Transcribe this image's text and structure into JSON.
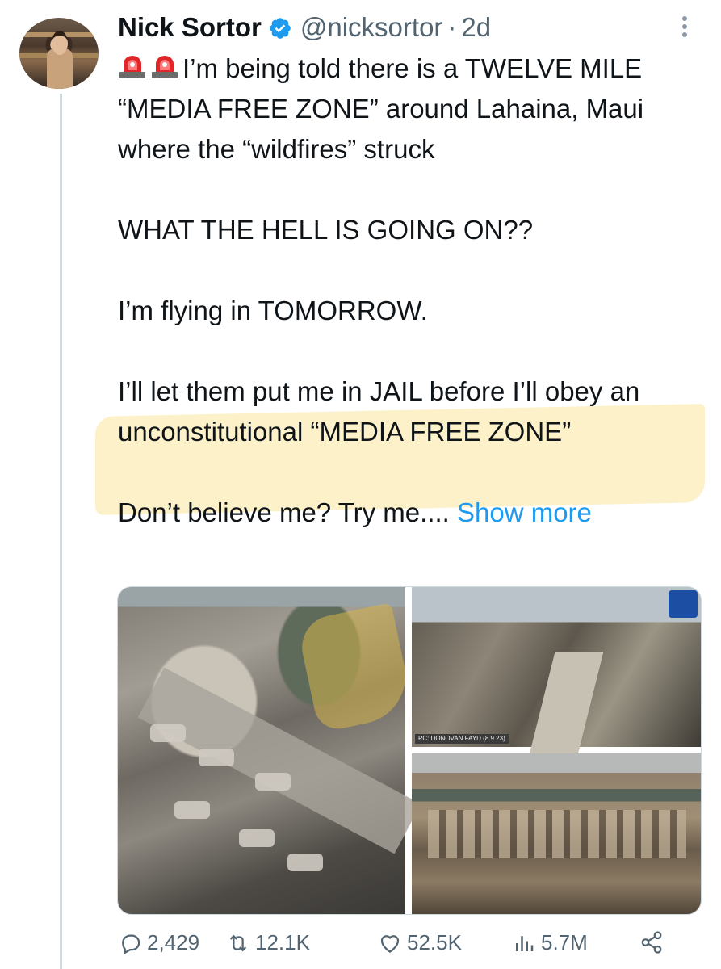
{
  "author": {
    "display_name": "Nick Sortor",
    "handle": "@nicksortor",
    "separator": "·",
    "time": "2d",
    "verified": true
  },
  "tweet": {
    "line1": "I’m being told there is a TWELVE MILE “MEDIA FREE ZONE” around Lahaina, Maui where the “wildfires” struck",
    "line2": "WHAT THE HELL IS GOING ON??",
    "line3": "I’m flying in TOMORROW.",
    "line4": "I’ll let them put me in JAIL before I’ll obey an unconstitutional “MEDIA FREE ZONE”",
    "line5": "Don’t believe me? Try me....",
    "show_more": "Show more",
    "emoji_prefix": "siren-emoji x2"
  },
  "media": {
    "photo_credit": "PC: DONOVAN FAYD (8.9.23)"
  },
  "actions": {
    "replies": "2,429",
    "retweets": "12.1K",
    "likes": "52.5K",
    "views": "5.7M"
  },
  "colors": {
    "link": "#1d9bf0",
    "muted": "#536471",
    "verified": "#1d9bf0",
    "highlight": "#fdefc0"
  }
}
